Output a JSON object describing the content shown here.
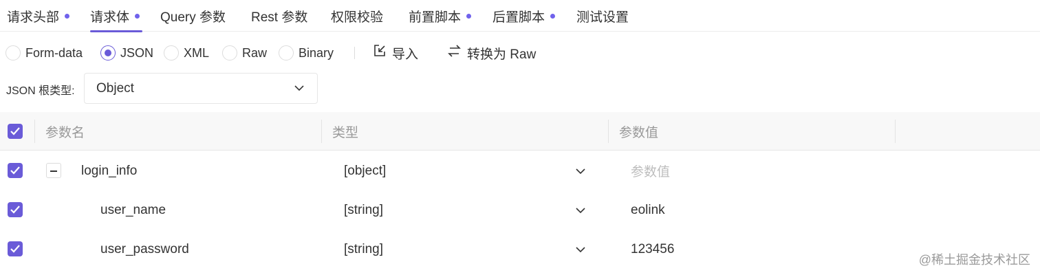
{
  "tabs": [
    {
      "label": "请求头部",
      "dot": true
    },
    {
      "label": "请求体",
      "dot": true,
      "active": true
    },
    {
      "label": "Query 参数",
      "dot": false
    },
    {
      "label": "Rest 参数",
      "dot": false
    },
    {
      "label": "权限校验",
      "dot": false
    },
    {
      "label": "前置脚本",
      "dot": true
    },
    {
      "label": "后置脚本",
      "dot": true
    },
    {
      "label": "测试设置",
      "dot": false
    }
  ],
  "body_types": [
    {
      "label": "Form-data",
      "checked": false
    },
    {
      "label": "JSON",
      "checked": true
    },
    {
      "label": "XML",
      "checked": false
    },
    {
      "label": "Raw",
      "checked": false
    },
    {
      "label": "Binary",
      "checked": false
    }
  ],
  "actions": {
    "import_label": "导入",
    "convert_label": "转换为 Raw"
  },
  "root_type": {
    "label": "JSON 根类型:",
    "value": "Object"
  },
  "table": {
    "headers": {
      "name": "参数名",
      "type": "类型",
      "value": "参数值"
    },
    "rows": [
      {
        "name": "login_info",
        "type": "[object]",
        "value": "参数值",
        "value_is_placeholder": true,
        "checked": true
      },
      {
        "name": "user_name",
        "type": "[string]",
        "value": "eolink",
        "value_is_placeholder": false,
        "checked": true
      },
      {
        "name": "user_password",
        "type": "[string]",
        "value": "123456",
        "value_is_placeholder": false,
        "checked": true
      }
    ]
  },
  "watermark": "@稀土掘金技术社区",
  "colors": {
    "accent": "#6a5bd8",
    "dot": "#7062ec"
  }
}
